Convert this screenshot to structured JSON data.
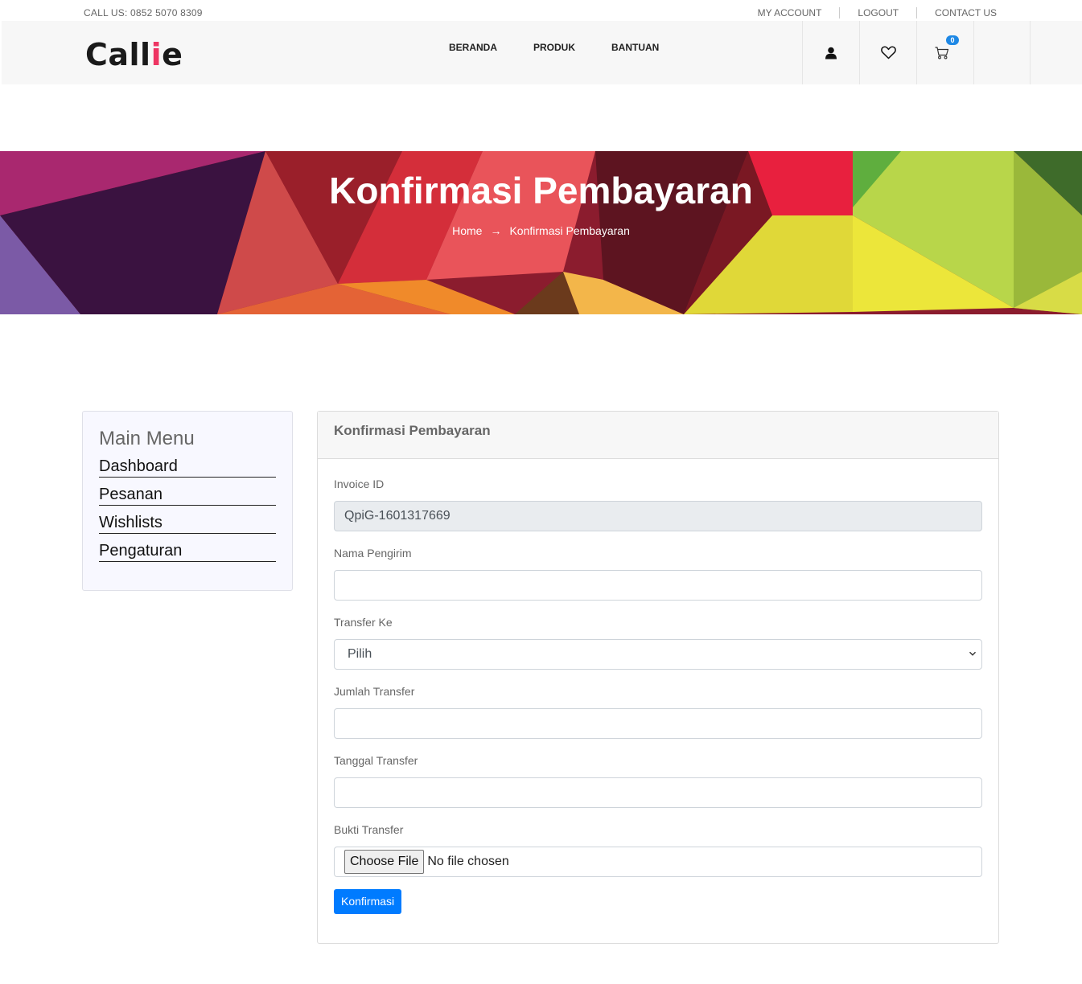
{
  "topbar": {
    "call": "CALL US: 0852 5070 8309",
    "links": [
      "MY ACCOUNT",
      "LOGOUT",
      "CONTACT US"
    ]
  },
  "header": {
    "logo_main": "Call",
    "logo_accent": "i",
    "logo_end": "e",
    "nav": [
      "BERANDA",
      "PRODUK",
      "BANTUAN"
    ],
    "cart_count": "0",
    "icons": [
      "user-icon",
      "heart-icon",
      "cart-icon"
    ]
  },
  "banner": {
    "title": "Konfirmasi Pembayaran",
    "breadcrumb_home": "Home",
    "breadcrumb_arrow": "→",
    "breadcrumb_current": "Konfirmasi Pembayaran"
  },
  "sidebar": {
    "title": "Main Menu",
    "items": [
      "Dashboard",
      "Pesanan",
      "Wishlists",
      "Pengaturan"
    ]
  },
  "form": {
    "card_title": "Konfirmasi Pembayaran",
    "invoice_label": "Invoice ID",
    "invoice_value": "QpiG-1601317669",
    "sender_label": "Nama Pengirim",
    "sender_value": "",
    "transfer_to_label": "Transfer Ke",
    "transfer_to_value": "Pilih",
    "amount_label": "Jumlah Transfer",
    "amount_value": "",
    "date_label": "Tanggal Transfer",
    "date_value": "",
    "proof_label": "Bukti Transfer",
    "file_button": "Choose File",
    "file_status": "No file chosen",
    "submit_label": "Konfirmasi"
  },
  "colors": {
    "brand_accent": "#ee3563",
    "primary": "#007bff",
    "badge": "#1e88e5"
  }
}
